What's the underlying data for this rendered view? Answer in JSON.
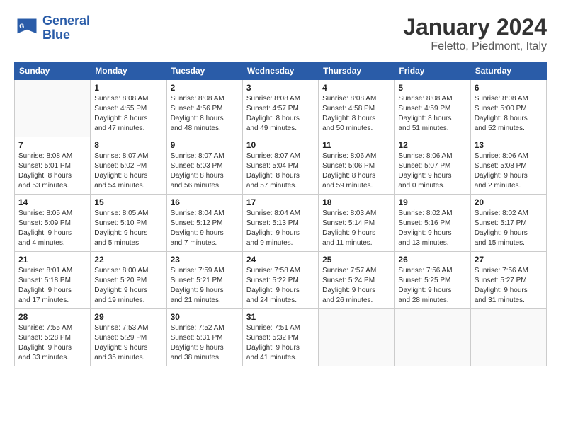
{
  "header": {
    "logo_line1": "General",
    "logo_line2": "Blue",
    "month": "January 2024",
    "location": "Feletto, Piedmont, Italy"
  },
  "weekdays": [
    "Sunday",
    "Monday",
    "Tuesday",
    "Wednesday",
    "Thursday",
    "Friday",
    "Saturday"
  ],
  "weeks": [
    [
      {
        "day": "",
        "info": ""
      },
      {
        "day": "1",
        "info": "Sunrise: 8:08 AM\nSunset: 4:55 PM\nDaylight: 8 hours\nand 47 minutes."
      },
      {
        "day": "2",
        "info": "Sunrise: 8:08 AM\nSunset: 4:56 PM\nDaylight: 8 hours\nand 48 minutes."
      },
      {
        "day": "3",
        "info": "Sunrise: 8:08 AM\nSunset: 4:57 PM\nDaylight: 8 hours\nand 49 minutes."
      },
      {
        "day": "4",
        "info": "Sunrise: 8:08 AM\nSunset: 4:58 PM\nDaylight: 8 hours\nand 50 minutes."
      },
      {
        "day": "5",
        "info": "Sunrise: 8:08 AM\nSunset: 4:59 PM\nDaylight: 8 hours\nand 51 minutes."
      },
      {
        "day": "6",
        "info": "Sunrise: 8:08 AM\nSunset: 5:00 PM\nDaylight: 8 hours\nand 52 minutes."
      }
    ],
    [
      {
        "day": "7",
        "info": "Sunrise: 8:08 AM\nSunset: 5:01 PM\nDaylight: 8 hours\nand 53 minutes."
      },
      {
        "day": "8",
        "info": "Sunrise: 8:07 AM\nSunset: 5:02 PM\nDaylight: 8 hours\nand 54 minutes."
      },
      {
        "day": "9",
        "info": "Sunrise: 8:07 AM\nSunset: 5:03 PM\nDaylight: 8 hours\nand 56 minutes."
      },
      {
        "day": "10",
        "info": "Sunrise: 8:07 AM\nSunset: 5:04 PM\nDaylight: 8 hours\nand 57 minutes."
      },
      {
        "day": "11",
        "info": "Sunrise: 8:06 AM\nSunset: 5:06 PM\nDaylight: 8 hours\nand 59 minutes."
      },
      {
        "day": "12",
        "info": "Sunrise: 8:06 AM\nSunset: 5:07 PM\nDaylight: 9 hours\nand 0 minutes."
      },
      {
        "day": "13",
        "info": "Sunrise: 8:06 AM\nSunset: 5:08 PM\nDaylight: 9 hours\nand 2 minutes."
      }
    ],
    [
      {
        "day": "14",
        "info": "Sunrise: 8:05 AM\nSunset: 5:09 PM\nDaylight: 9 hours\nand 4 minutes."
      },
      {
        "day": "15",
        "info": "Sunrise: 8:05 AM\nSunset: 5:10 PM\nDaylight: 9 hours\nand 5 minutes."
      },
      {
        "day": "16",
        "info": "Sunrise: 8:04 AM\nSunset: 5:12 PM\nDaylight: 9 hours\nand 7 minutes."
      },
      {
        "day": "17",
        "info": "Sunrise: 8:04 AM\nSunset: 5:13 PM\nDaylight: 9 hours\nand 9 minutes."
      },
      {
        "day": "18",
        "info": "Sunrise: 8:03 AM\nSunset: 5:14 PM\nDaylight: 9 hours\nand 11 minutes."
      },
      {
        "day": "19",
        "info": "Sunrise: 8:02 AM\nSunset: 5:16 PM\nDaylight: 9 hours\nand 13 minutes."
      },
      {
        "day": "20",
        "info": "Sunrise: 8:02 AM\nSunset: 5:17 PM\nDaylight: 9 hours\nand 15 minutes."
      }
    ],
    [
      {
        "day": "21",
        "info": "Sunrise: 8:01 AM\nSunset: 5:18 PM\nDaylight: 9 hours\nand 17 minutes."
      },
      {
        "day": "22",
        "info": "Sunrise: 8:00 AM\nSunset: 5:20 PM\nDaylight: 9 hours\nand 19 minutes."
      },
      {
        "day": "23",
        "info": "Sunrise: 7:59 AM\nSunset: 5:21 PM\nDaylight: 9 hours\nand 21 minutes."
      },
      {
        "day": "24",
        "info": "Sunrise: 7:58 AM\nSunset: 5:22 PM\nDaylight: 9 hours\nand 24 minutes."
      },
      {
        "day": "25",
        "info": "Sunrise: 7:57 AM\nSunset: 5:24 PM\nDaylight: 9 hours\nand 26 minutes."
      },
      {
        "day": "26",
        "info": "Sunrise: 7:56 AM\nSunset: 5:25 PM\nDaylight: 9 hours\nand 28 minutes."
      },
      {
        "day": "27",
        "info": "Sunrise: 7:56 AM\nSunset: 5:27 PM\nDaylight: 9 hours\nand 31 minutes."
      }
    ],
    [
      {
        "day": "28",
        "info": "Sunrise: 7:55 AM\nSunset: 5:28 PM\nDaylight: 9 hours\nand 33 minutes."
      },
      {
        "day": "29",
        "info": "Sunrise: 7:53 AM\nSunset: 5:29 PM\nDaylight: 9 hours\nand 35 minutes."
      },
      {
        "day": "30",
        "info": "Sunrise: 7:52 AM\nSunset: 5:31 PM\nDaylight: 9 hours\nand 38 minutes."
      },
      {
        "day": "31",
        "info": "Sunrise: 7:51 AM\nSunset: 5:32 PM\nDaylight: 9 hours\nand 41 minutes."
      },
      {
        "day": "",
        "info": ""
      },
      {
        "day": "",
        "info": ""
      },
      {
        "day": "",
        "info": ""
      }
    ]
  ]
}
